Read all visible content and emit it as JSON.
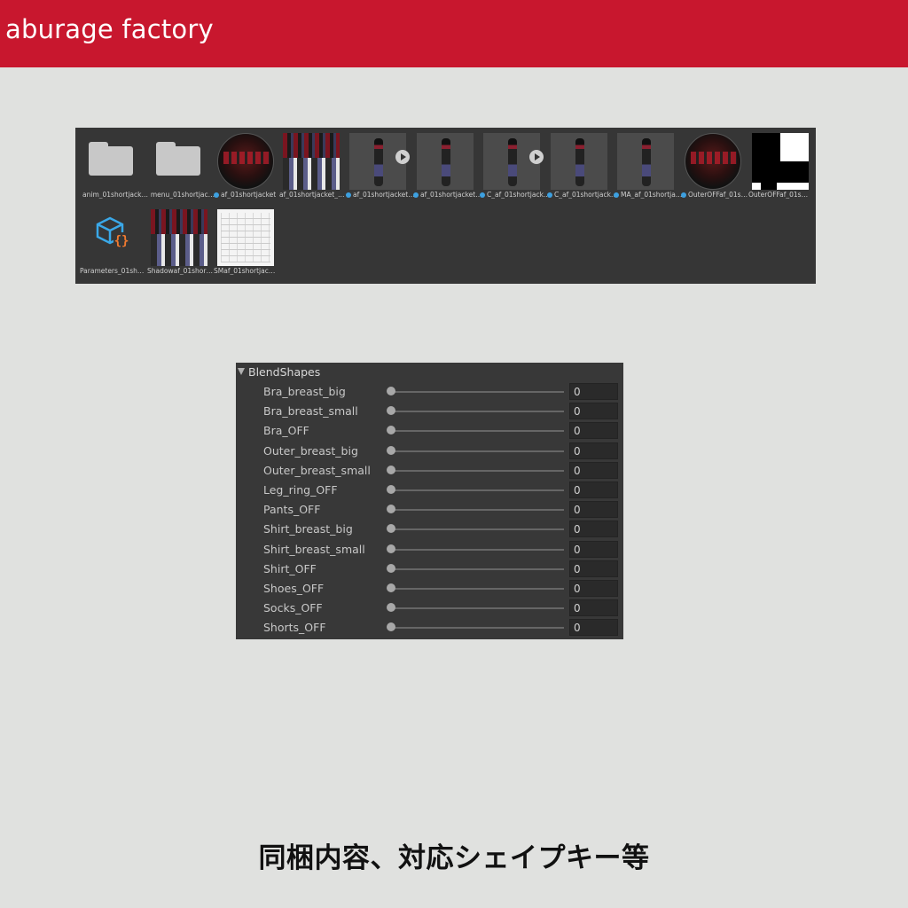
{
  "header": {
    "title": "aburage factory"
  },
  "project_assets": [
    {
      "name": "anim_01shortjack…",
      "icon": "folder-icon"
    },
    {
      "name": "menu_01shortjac…",
      "icon": "folder-icon"
    },
    {
      "name": "af_01shortjacket",
      "icon": "material-sphere-icon"
    },
    {
      "name": "af_01shortjacket_…",
      "icon": "texture-icon"
    },
    {
      "name": "af_01shortjacket…",
      "icon": "prefab-model-icon"
    },
    {
      "name": "af_01shortjacket…",
      "icon": "prefab-model-icon"
    },
    {
      "name": "C_af_01shortjack…",
      "icon": "prefab-model-icon"
    },
    {
      "name": "C_af_01shortjack…",
      "icon": "prefab-model-icon"
    },
    {
      "name": "MA_af_01shortja…",
      "icon": "prefab-model-icon"
    },
    {
      "name": "OuterOFFaf_01s…",
      "icon": "material-sphere-icon"
    },
    {
      "name": "OuterOFFaf_01s…",
      "icon": "mask-texture-icon"
    },
    {
      "name": "Parameters_01sh…",
      "icon": "parameters-icon"
    },
    {
      "name": "Shadowaf_01shor…",
      "icon": "texture-icon"
    },
    {
      "name": "SMaf_01shortjac…",
      "icon": "sketch-texture-icon"
    }
  ],
  "blendshapes": {
    "header": "BlendShapes",
    "items": [
      {
        "label": "Bra_breast_big",
        "value": "0"
      },
      {
        "label": "Bra_breast_small",
        "value": "0"
      },
      {
        "label": "Bra_OFF",
        "value": "0"
      },
      {
        "label": "Outer_breast_big",
        "value": "0"
      },
      {
        "label": "Outer_breast_small",
        "value": "0"
      },
      {
        "label": "Leg_ring_OFF",
        "value": "0"
      },
      {
        "label": "Pants_OFF",
        "value": "0"
      },
      {
        "label": "Shirt_breast_big",
        "value": "0"
      },
      {
        "label": "Shirt_breast_small",
        "value": "0"
      },
      {
        "label": "Shirt_OFF",
        "value": "0"
      },
      {
        "label": "Shoes_OFF",
        "value": "0"
      },
      {
        "label": "Socks_OFF",
        "value": "0"
      },
      {
        "label": "Shorts_OFF",
        "value": "0"
      }
    ]
  },
  "caption": "同梱内容、対応シェイプキー等",
  "colors": {
    "header_bg": "#c8172e",
    "page_bg": "#e0e1df",
    "panel_bg": "#363636"
  }
}
